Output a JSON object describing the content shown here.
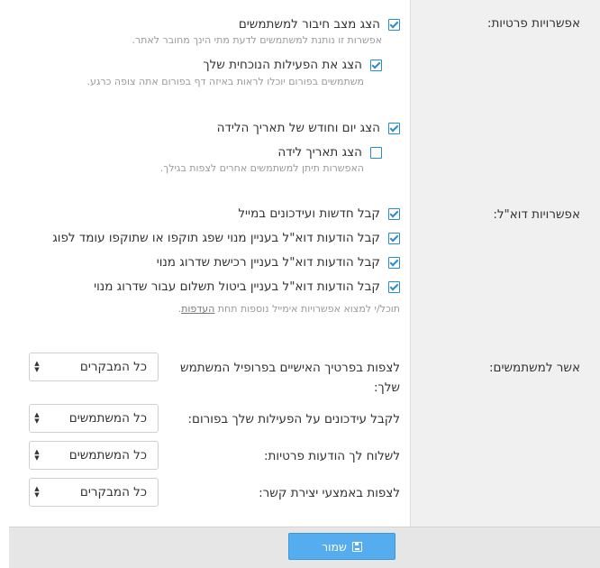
{
  "privacy": {
    "section_label": "אפשרויות פרטיות:",
    "options": [
      {
        "label": "הצג מצב חיבור למשתמשים",
        "checked": true,
        "hint": "אפשרות זו נותנת למשתמשים לדעת מתי הינך מחובר לאתר."
      },
      {
        "label": "הצג את הפעילות הנוכחית שלך",
        "checked": true,
        "hint": "משתמשים בפורום יוכלו לראות באיזה דף בפורום אתה צופה כרגע."
      },
      {
        "label": "הצג יום וחודש של תאריך הלידה",
        "checked": true,
        "hint": ""
      },
      {
        "label": "הצג תאריך לידה",
        "checked": false,
        "hint": "האפשרות תיתן למשתמשים אחרים לצפות בגילך."
      }
    ]
  },
  "email": {
    "section_label": "אפשרויות דוא\"ל:",
    "options": [
      {
        "label": "קבל חדשות ועידכונים במייל",
        "checked": true
      },
      {
        "label": "קבל הודעות דוא\"ל בעניין מנוי שפג תוקפו או שתוקפו עומד לפוג",
        "checked": true
      },
      {
        "label": "קבל הודעות דוא\"ל בעניין רכישת שדרוג מנוי",
        "checked": true
      },
      {
        "label": "קבל הודעות דוא\"ל בעניין ביטול תשלום עבור שדרוג מנוי",
        "checked": true
      }
    ],
    "hint_text": "תוכל/י למצוא אפשרויות אימייל נוספות תחת ",
    "hint_link": "העדפות",
    "hint_end": "."
  },
  "permissions": {
    "section_label": "אשר למשתמשים:",
    "fields": [
      {
        "label": "לצפות בפרטיך האישיים בפרופיל המשתמש שלך:",
        "value": "כל המבקרים"
      },
      {
        "label": "לקבל עידכונים על הפעילות שלך בפורום:",
        "value": "כל המשתמשים"
      },
      {
        "label": "לשלוח לך הודעות פרטיות:",
        "value": "כל המשתמשים"
      },
      {
        "label": "לצפות באמצעי יצירת קשר:",
        "value": "כל המבקרים"
      }
    ]
  },
  "footer": {
    "save_label": "שמור",
    "save_icon": "floppy-disk-icon"
  },
  "colors": {
    "accent": "#55acef",
    "checkbox": "#2a8bd0",
    "label_column_bg": "#f0f0f0",
    "footer_bg": "#e6e6e6"
  }
}
